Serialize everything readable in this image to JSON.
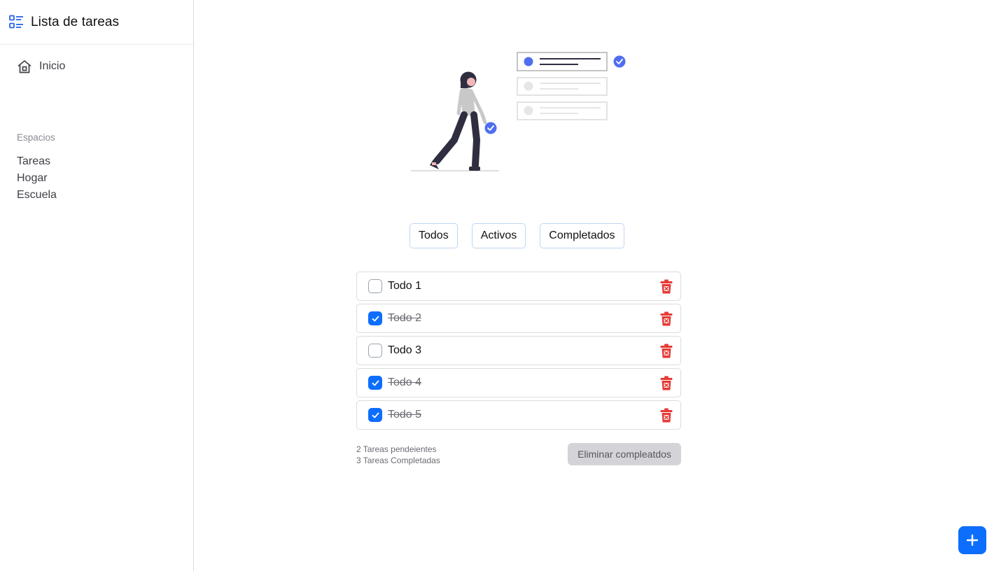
{
  "app": {
    "title": "Lista de tareas",
    "brand_icon": "checklist-icon",
    "accent_color": "#0d6efd"
  },
  "sidebar": {
    "home": {
      "label": "Inicio",
      "icon": "home-icon"
    },
    "section_title": "Espacios",
    "spaces": [
      {
        "label": "Tareas"
      },
      {
        "label": "Hogar"
      },
      {
        "label": "Escuela"
      }
    ]
  },
  "filters": [
    {
      "label": "Todos"
    },
    {
      "label": "Activos"
    },
    {
      "label": "Completados"
    }
  ],
  "todos": [
    {
      "text": "Todo 1",
      "completed": false
    },
    {
      "text": "Todo 2",
      "completed": true
    },
    {
      "text": "Todo 3",
      "completed": false
    },
    {
      "text": "Todo 4",
      "completed": true
    },
    {
      "text": "Todo 5",
      "completed": true
    }
  ],
  "footer": {
    "pending_text": "2 Tareas pendeientes",
    "completed_text": "3 Tareas Completadas",
    "clear_label": "Eliminar compleatdos"
  },
  "fab": {
    "icon": "plus-icon",
    "color": "#0d6efd"
  },
  "delete_icon_color": "#e53935"
}
